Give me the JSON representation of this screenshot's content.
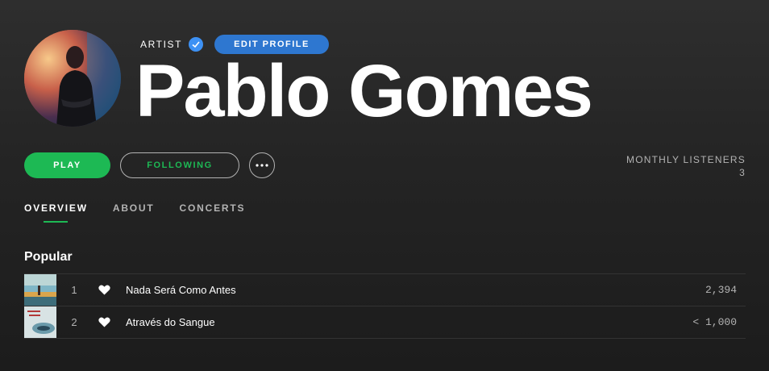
{
  "artist": {
    "label": "ARTIST",
    "name": "Pablo Gomes",
    "edit_profile_label": "EDIT PROFILE",
    "verified_icon": "checkmark-badge-icon"
  },
  "actions": {
    "play_label": "PLAY",
    "following_label": "FOLLOWING",
    "more_icon": "ellipsis-icon"
  },
  "listeners": {
    "label": "MONTHLY LISTENERS",
    "value": "3"
  },
  "tabs": [
    {
      "label": "OVERVIEW",
      "active": true
    },
    {
      "label": "ABOUT",
      "active": false
    },
    {
      "label": "CONCERTS",
      "active": false
    }
  ],
  "popular": {
    "title": "Popular",
    "tracks": [
      {
        "number": "1",
        "title": "Nada Será Como Antes",
        "plays": "2,394",
        "liked": true
      },
      {
        "number": "2",
        "title": "Através do Sangue",
        "plays": "< 1,000",
        "liked": true
      }
    ]
  },
  "colors": {
    "accent_green": "#1db954",
    "edit_blue": "#2e77d0",
    "verified_blue": "#3d91f4",
    "muted_text": "#b3b3b3"
  }
}
